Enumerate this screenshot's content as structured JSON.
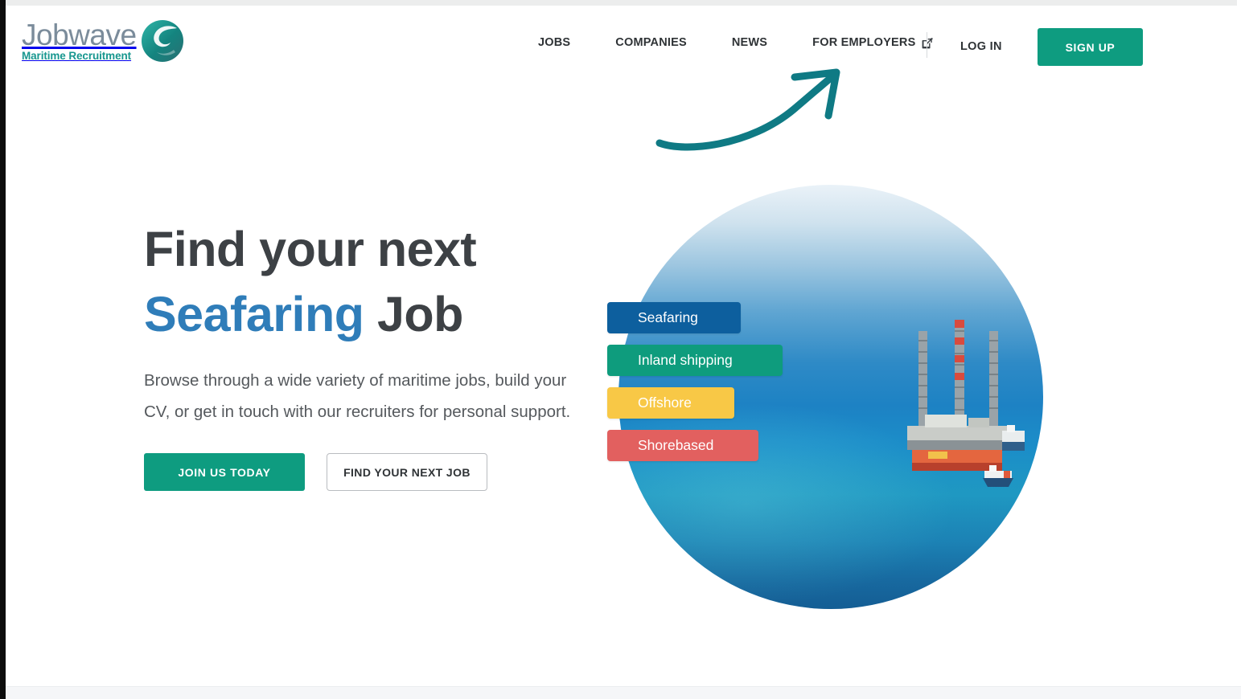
{
  "brand": {
    "logo_word": "Jobwave",
    "logo_tagline": "Maritime Recruitment",
    "logo_mark_icon": "wave-circle-icon",
    "word_color": "#7b8c9b",
    "tagline_color": "#17978f",
    "mark_color": "#17978f"
  },
  "header": {
    "nav": [
      {
        "label": "JOBS",
        "icon": null
      },
      {
        "label": "COMPANIES",
        "icon": null
      },
      {
        "label": "NEWS",
        "icon": null
      },
      {
        "label": "FOR EMPLOYERS",
        "icon": "external-link-icon"
      }
    ],
    "login_label": "LOG IN",
    "signup_label": "SIGN UP",
    "signup_color": "#0e9c80"
  },
  "annotation": {
    "type": "curved-arrow",
    "points_to": "FOR EMPLOYERS",
    "color": "#0f7a84"
  },
  "hero": {
    "title_line1": "Find your next",
    "title_line2_accent": "Seafaring",
    "title_line2_rest": " Job",
    "title_color": "#3d4145",
    "accent_color": "#2f7db9",
    "subtitle": "Browse through a wide variety of maritime jobs, build your CV, or get in touch with our recruiters for personal support.",
    "primary_cta": "JOIN US TODAY",
    "secondary_cta": "FIND YOUR NEXT JOB",
    "primary_cta_color": "#0e9c80",
    "image_alt": "offshore-oil-rig-ocean-photo",
    "categories": [
      {
        "label": "Seafaring",
        "color": "#0d5f9e"
      },
      {
        "label": "Inland shipping",
        "color": "#0e9c7d"
      },
      {
        "label": "Offshore",
        "color": "#f8c846"
      },
      {
        "label": "Shorebased",
        "color": "#e2605f"
      }
    ]
  }
}
